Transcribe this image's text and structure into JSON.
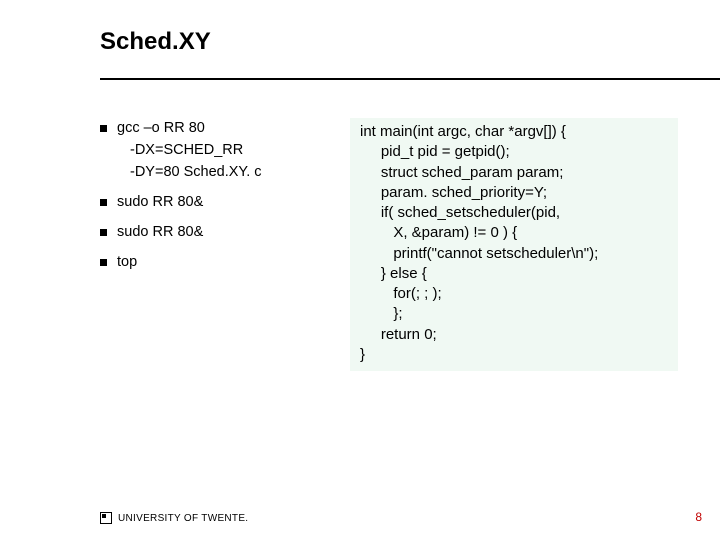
{
  "title": "Sched.XY",
  "bullets": {
    "b1": "gcc –o RR 80",
    "b1_sub1": "-DX=SCHED_RR",
    "b1_sub2": "-DY=80 Sched.XY. c",
    "b2": "sudo RR 80&",
    "b3": "sudo RR 80&",
    "b4": "top"
  },
  "code": {
    "l0": "int main(int argc, char *argv[]) {",
    "l1": "     pid_t pid = getpid();",
    "l2": "     struct sched_param param;",
    "l3": "     param. sched_priority=Y;",
    "l4": "     if( sched_setscheduler(pid,",
    "l5": "        X, &param) != 0 ) {",
    "l6": "        printf(\"cannot setscheduler\\n\");",
    "l7": "     } else {",
    "l8": "        for(; ; );",
    "l9": "        };",
    "l10": "     return 0;",
    "l11": "}"
  },
  "footer": "UNIVERSITY OF TWENTE.",
  "page": "8"
}
